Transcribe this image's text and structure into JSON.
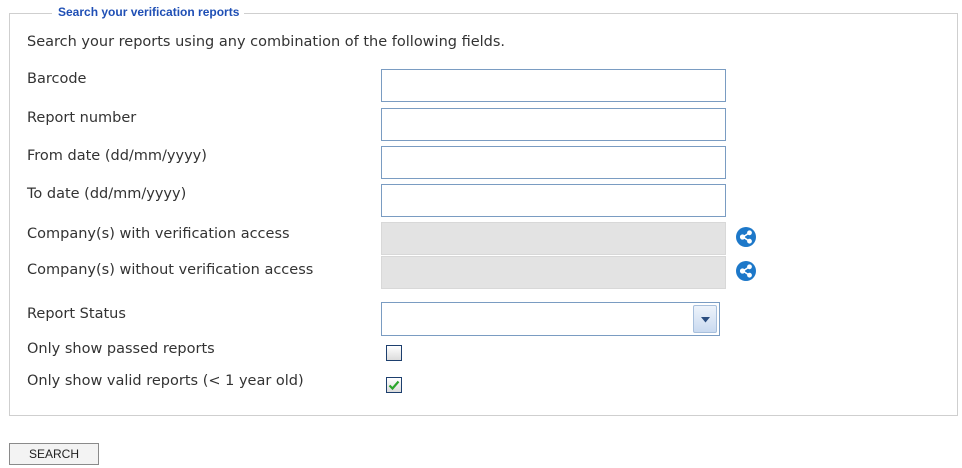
{
  "form": {
    "legend": "Search your verification reports",
    "intro": "Search your reports using any combination of the following fields.",
    "fields": {
      "barcode": {
        "label": "Barcode",
        "value": ""
      },
      "report_number": {
        "label": "Report number",
        "value": ""
      },
      "from_date": {
        "label": "From date (dd/mm/yyyy)",
        "value": ""
      },
      "to_date": {
        "label": "To date (dd/mm/yyyy)",
        "value": ""
      },
      "companies_with": {
        "label": "Company(s) with verification access",
        "value": "",
        "icon": "share-icon"
      },
      "companies_without": {
        "label": "Company(s) without verification access",
        "value": "",
        "icon": "share-icon"
      },
      "report_status": {
        "label": "Report Status",
        "selected": ""
      },
      "only_passed": {
        "label": "Only show passed reports",
        "checked": false
      },
      "only_valid": {
        "label": "Only show valid reports (< 1 year old)",
        "checked": true
      }
    }
  },
  "actions": {
    "search_label": "SEARCH"
  },
  "colors": {
    "legend": "#1f4fb5",
    "icon": "#1d78c9",
    "check": "#2aa52a",
    "disabled_field": "#e3e3e3"
  }
}
